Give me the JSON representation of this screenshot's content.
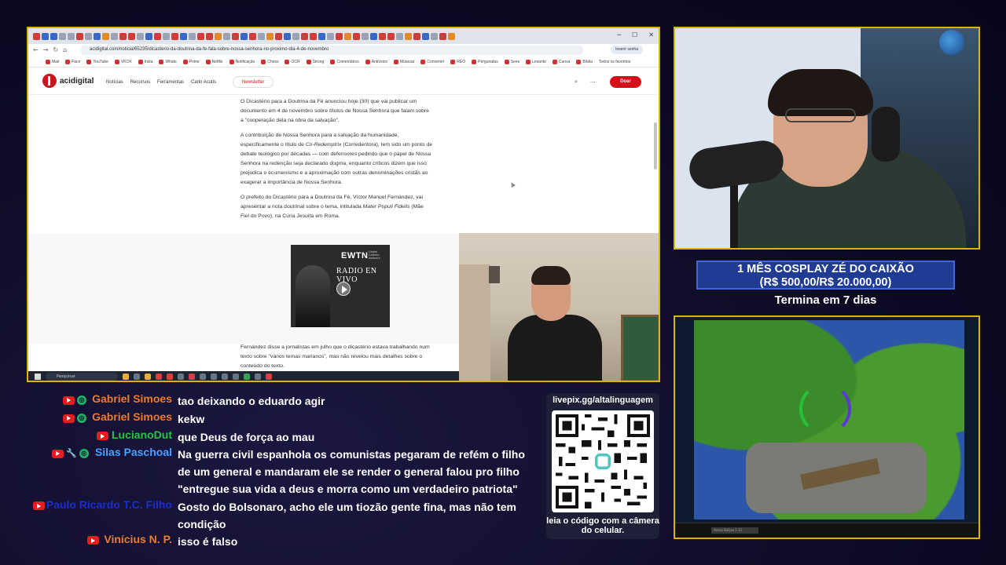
{
  "browser": {
    "url": "acidigital.com/noticia/65235/dicasterio-da-doutrina-da-fe-fala-sobre-nossa-senhora-no-proximo-dia-4-de-novembro",
    "login_chip": "Inserir senha",
    "bookmarks": [
      "Mail",
      "Face",
      "YouTube",
      "VKCK",
      "Insta",
      "Whats",
      "Prime",
      "Netflix",
      "Notificação",
      "Chess",
      "OCR",
      "Strong",
      "Comentários",
      "Antivoice",
      "Músicas",
      "Converter",
      "REO",
      "Pergunatas",
      "Sees",
      "Lesante",
      "Canva",
      "Bíblia",
      "Todos os favoritos"
    ],
    "taskbar_search": "Pesquisar"
  },
  "site": {
    "logo": "acidigital",
    "menu": [
      "Notícias",
      "Recursos",
      "Ferramentas",
      "Carlo Acutis"
    ],
    "newsletter": "Newsletter",
    "donate": "Doar"
  },
  "article": {
    "p1": "O Dicastério para a Doutrina da Fé anunciou hoje (30) que vai publicar um documento em 4 de novembro sobre títulos de Nossa Senhora que falam sobre a \"cooperação dela na obra da salvação\".",
    "p2a": "A contribuição de Nossa Senhora para a salvação da humanidade, especificamente o título de ",
    "p2b": "Co-Redemptrix",
    "p2c": " (Corredentora), tem sido um ponto de debate teológico por décadas — com defensores pedindo que o papel de Nossa Senhora na redenção seja declarado dogma, enquanto críticos dizem que isso prejudica o ecumenismo e a aproximação com outras denominações cristãs ao exagerar a importância de Nossa Senhora.",
    "p3a": "O prefeito do Dicastério para a Doutrina da Fé, Víctor Manuel Fernández, vai apresentar a nota doutrinal sobre o tema, intitulada ",
    "p3b": "Mater Populi Fidelis",
    "p3c": " (Mãe Fiel do Povo), na Cúria Jesuíta em Roma.",
    "p4": "Fernández disse a jornalistas em julho que o dicastério estava trabalhando num texto sobre \"vários temas marianos\", mas não revelou mais detalhes sobre o conteúdo do texto."
  },
  "ewtn": {
    "brand": "EWTN",
    "brand_small": "Global Catholic Network",
    "radio": "RADIO EN VIVO"
  },
  "goal": {
    "line1": "1 MÊS COSPLAY ZÉ DO CAIXÃO",
    "line2": "(R$ 500,00/R$ 20.000,00)",
    "ends": "Termina em 7 dias"
  },
  "game": {
    "hud_label": "Arena Bolijse 1.11"
  },
  "chat": [
    {
      "user": "Gabriel Simoes",
      "color": "#f07a2a",
      "badges": [
        "youtube",
        "member"
      ],
      "text": "tao deixando o eduardo agir"
    },
    {
      "user": "Gabriel Simoes",
      "color": "#f07a2a",
      "badges": [
        "youtube",
        "member"
      ],
      "text": "kekw"
    },
    {
      "user": "LucianoDut",
      "color": "#27c24a",
      "badges": [
        "youtube"
      ],
      "text": "que Deus de força ao mau"
    },
    {
      "user": "Silas Paschoal",
      "color": "#4aa0ff",
      "badges": [
        "youtube",
        "moderator",
        "member"
      ],
      "text": "Na guerra civil espanhola os comunistas pegaram de refém o filho de um general e mandaram ele se render o general falou pro filho \"entregue sua vida a deus e morra como um verdadeiro patriota\""
    },
    {
      "user": "Paulo Ricardo T.C. Filho",
      "color": "#1b2cd0",
      "badges": [
        "youtube"
      ],
      "text": "Gosto do Bolsonaro, acho ele um tiozão gente fina, mas não tem condição"
    },
    {
      "user": "Vinícius N. P.",
      "color": "#f07a2a",
      "badges": [
        "youtube"
      ],
      "text": "isso é falso"
    }
  ],
  "qr": {
    "url": "livepix.gg/altalinguagem",
    "caption": "leia o código com a câmera do celular."
  }
}
